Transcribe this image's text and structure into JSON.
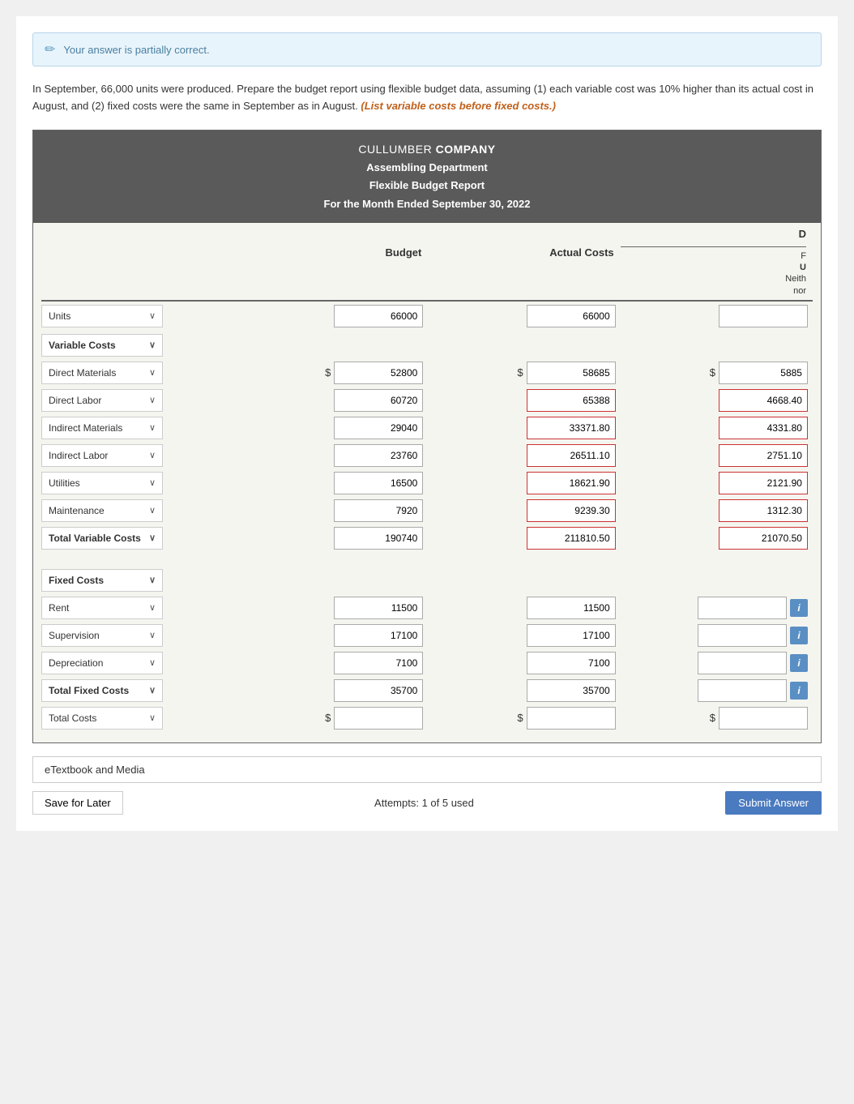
{
  "alert": {
    "icon": "✏",
    "text": "Your answer is partially correct."
  },
  "instruction": {
    "main": "In September, 66,000 units were produced. Prepare the budget report using flexible budget data, assuming (1) each variable cost was 10% higher than its actual cost in August, and (2) fixed costs were the same in September as in August.",
    "highlight": "(List variable costs before fixed costs.)"
  },
  "report": {
    "title_line1": "CULLUMBER ",
    "title_line1_bold": "COMPANY",
    "title_line2": "Assembling Department",
    "title_line3": "Flexible Budget Report",
    "title_line4": "For the Month Ended September 30, 2022"
  },
  "col_headers": {
    "budget": "Budget",
    "actual": "Actual Costs",
    "diff_top": "D",
    "diff_mid1": "F",
    "diff_mid2": "U",
    "diff_mid3": "Neith",
    "diff_bottom": "nor"
  },
  "rows": [
    {
      "label": "Units",
      "chevron": true,
      "budget": "66000",
      "actual": "66000",
      "diff": "",
      "showDollar": false,
      "diffType": "plain",
      "rowType": "normal"
    },
    {
      "label": "Variable Costs",
      "chevron": true,
      "budget": "",
      "actual": "",
      "diff": "",
      "showDollar": false,
      "diffType": "none",
      "rowType": "section"
    },
    {
      "label": "Direct Materials",
      "chevron": true,
      "budget": "52800",
      "actual": "58685",
      "diff": "5885",
      "showDollar": true,
      "diffType": "plain",
      "rowType": "normal"
    },
    {
      "label": "Direct Labor",
      "chevron": true,
      "budget": "60720",
      "actual": "65388",
      "diff": "4668.40",
      "showDollar": false,
      "diffType": "red",
      "rowType": "normal"
    },
    {
      "label": "Indirect Materials",
      "chevron": true,
      "budget": "29040",
      "actual": "33371.80",
      "diff": "4331.80",
      "showDollar": false,
      "diffType": "red",
      "rowType": "normal"
    },
    {
      "label": "Indirect Labor",
      "chevron": true,
      "budget": "23760",
      "actual": "26511.10",
      "diff": "2751.10",
      "showDollar": false,
      "diffType": "red",
      "rowType": "normal"
    },
    {
      "label": "Utilities",
      "chevron": true,
      "budget": "16500",
      "actual": "18621.90",
      "diff": "2121.90",
      "showDollar": false,
      "diffType": "red",
      "rowType": "normal"
    },
    {
      "label": "Maintenance",
      "chevron": true,
      "budget": "7920",
      "actual": "9239.30",
      "diff": "1312.30",
      "showDollar": false,
      "diffType": "red",
      "rowType": "normal"
    },
    {
      "label": "Total Variable Costs",
      "chevron": true,
      "budget": "190740",
      "actual": "211810.50",
      "diff": "21070.50",
      "showDollar": false,
      "diffType": "red",
      "rowType": "total"
    },
    {
      "label": "Fixed Costs",
      "chevron": true,
      "budget": "",
      "actual": "",
      "diff": "",
      "showDollar": false,
      "diffType": "none",
      "rowType": "section"
    },
    {
      "label": "Rent",
      "chevron": true,
      "budget": "11500",
      "actual": "11500",
      "diff": "",
      "showDollar": false,
      "diffType": "info",
      "rowType": "normal"
    },
    {
      "label": "Supervision",
      "chevron": true,
      "budget": "17100",
      "actual": "17100",
      "diff": "",
      "showDollar": false,
      "diffType": "info",
      "rowType": "normal"
    },
    {
      "label": "Depreciation",
      "chevron": true,
      "budget": "7100",
      "actual": "7100",
      "diff": "",
      "showDollar": false,
      "diffType": "info",
      "rowType": "normal"
    },
    {
      "label": "Total Fixed Costs",
      "chevron": true,
      "budget": "35700",
      "actual": "35700",
      "diff": "",
      "showDollar": false,
      "diffType": "info",
      "rowType": "total"
    },
    {
      "label": "Total Costs",
      "chevron": true,
      "budget": "",
      "actual": "",
      "diff": "",
      "showDollar": true,
      "diffType": "dollar",
      "rowType": "total-empty"
    }
  ],
  "footer": {
    "etextbook": "eTextbook and Media",
    "save_label": "Save for Later",
    "attempts_label": "Attempts: 1 of 5 used",
    "submit_label": "Submit Answer"
  }
}
